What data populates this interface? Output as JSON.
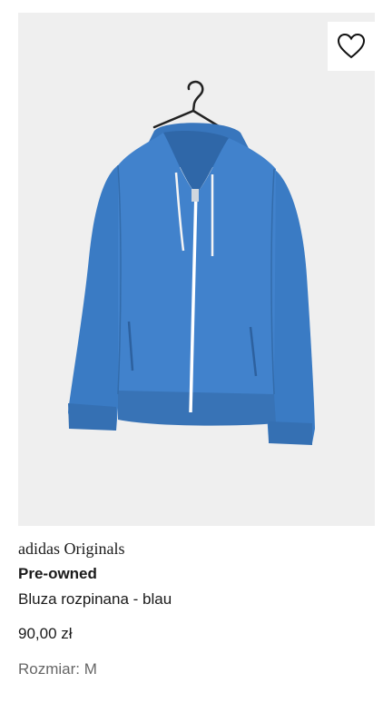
{
  "product": {
    "brand": "adidas Originals",
    "condition": "Pre-owned",
    "title": "Bluza rozpinana - blau",
    "price": "90,00 zł",
    "size_label": "Rozmiar:",
    "size_value": "M",
    "size_text": "Rozmiar: M",
    "image_alt": "blue zip-up hoodie on a hanger",
    "colors": {
      "garment": "#3f7fc6",
      "background": "#efefef",
      "text": "#1a1a1a",
      "muted_text": "#666666"
    }
  },
  "wishlist": {
    "icon": "heart-icon"
  }
}
